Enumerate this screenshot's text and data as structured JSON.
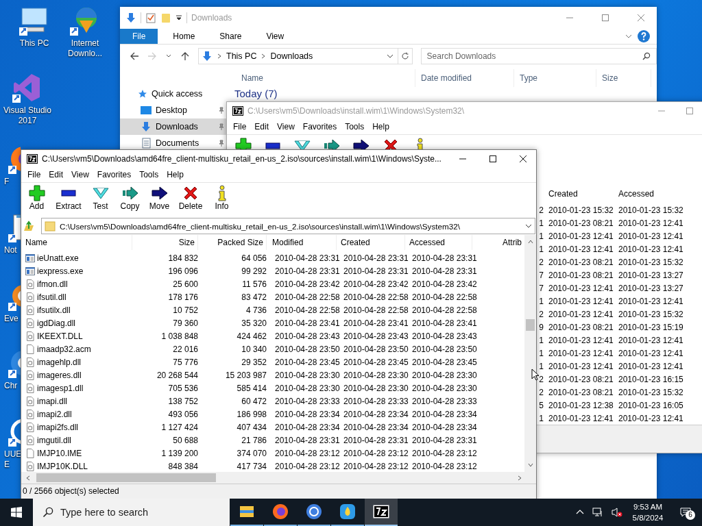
{
  "desktop_icons": [
    {
      "label": "This PC",
      "kind": "pc"
    },
    {
      "label": "Internet Downlo...",
      "kind": "idm"
    },
    {
      "label": "Visual Studio 2017",
      "kind": "vs"
    },
    {
      "label": "F",
      "kind": "firefox"
    },
    {
      "label": "Not",
      "kind": "notepad"
    },
    {
      "label": "Eve",
      "kind": "everything"
    },
    {
      "label": "Chr",
      "kind": "chrome"
    },
    {
      "label": "UUE E",
      "kind": "uue"
    }
  ],
  "explorer": {
    "title": "Downloads",
    "ribbon_tabs": [
      {
        "label": "File",
        "selected": true
      },
      {
        "label": "Home",
        "selected": false
      },
      {
        "label": "Share",
        "selected": false
      },
      {
        "label": "View",
        "selected": false
      }
    ],
    "breadcrumb": [
      "This PC",
      "Downloads"
    ],
    "search": {
      "placeholder": "Search Downloads"
    },
    "columns": [
      "Name",
      "Date modified",
      "Type",
      "Size"
    ],
    "group": "Today (7)",
    "nav": [
      {
        "label": "Quick access",
        "kind": "star",
        "pinned": false,
        "selected": false
      },
      {
        "label": "Desktop",
        "kind": "desktop",
        "pinned": true,
        "selected": false
      },
      {
        "label": "Downloads",
        "kind": "download",
        "pinned": true,
        "selected": true
      },
      {
        "label": "Documents",
        "kind": "documents",
        "pinned": true,
        "selected": false
      }
    ]
  },
  "back_window": {
    "title": "C:\\Users\\vm5\\Downloads\\install.wim\\1\\Windows\\System32\\",
    "menu": [
      "File",
      "Edit",
      "View",
      "Favorites",
      "Tools",
      "Help"
    ],
    "columns": [
      "Created",
      "Accessed"
    ],
    "rows": [
      {
        "modified_tail": "2",
        "created": "2010-01-23 15:32",
        "accessed": "2010-01-23 15:32"
      },
      {
        "modified_tail": "1",
        "created": "2010-01-23 08:21",
        "accessed": "2010-01-23 12:41"
      },
      {
        "modified_tail": "1",
        "created": "2010-01-23 12:41",
        "accessed": "2010-01-23 12:41"
      },
      {
        "modified_tail": "1",
        "created": "2010-01-23 12:41",
        "accessed": "2010-01-23 12:41"
      },
      {
        "modified_tail": "2",
        "created": "2010-01-23 08:21",
        "accessed": "2010-01-23 15:32"
      },
      {
        "modified_tail": "7",
        "created": "2010-01-23 08:21",
        "accessed": "2010-01-23 13:27"
      },
      {
        "modified_tail": "7",
        "created": "2010-01-23 12:41",
        "accessed": "2010-01-23 13:27"
      },
      {
        "modified_tail": "1",
        "created": "2010-01-23 12:41",
        "accessed": "2010-01-23 12:41"
      },
      {
        "modified_tail": "2",
        "created": "2010-01-23 12:41",
        "accessed": "2010-01-23 15:32"
      },
      {
        "modified_tail": "9",
        "created": "2010-01-23 08:21",
        "accessed": "2010-01-23 15:19"
      },
      {
        "modified_tail": "1",
        "created": "2010-01-23 12:41",
        "accessed": "2010-01-23 12:41"
      },
      {
        "modified_tail": "1",
        "created": "2010-01-23 12:41",
        "accessed": "2010-01-23 12:41"
      },
      {
        "modified_tail": "1",
        "created": "2010-01-23 12:41",
        "accessed": "2010-01-23 12:41"
      },
      {
        "modified_tail": "2",
        "created": "2010-01-23 08:21",
        "accessed": "2010-01-23 16:15"
      },
      {
        "modified_tail": "2",
        "created": "2010-01-23 08:21",
        "accessed": "2010-01-23 15:32"
      },
      {
        "modified_tail": "5",
        "created": "2010-01-23 12:38",
        "accessed": "2010-01-23 16:05"
      },
      {
        "modified_tail": "1",
        "created": "2010-01-23 12:41",
        "accessed": "2010-01-23 12:41"
      }
    ]
  },
  "front_window": {
    "title": "C:\\Users\\vm5\\Downloads\\amd64fre_client-multisku_retail_en-us_2.iso\\sources\\install.wim\\1\\Windows\\Syste...",
    "menu": [
      "File",
      "Edit",
      "View",
      "Favorites",
      "Tools",
      "Help"
    ],
    "toolbar": [
      {
        "label": "Add",
        "kind": "add"
      },
      {
        "label": "Extract",
        "kind": "extract"
      },
      {
        "label": "Test",
        "kind": "test"
      },
      {
        "label": "Copy",
        "kind": "copy"
      },
      {
        "label": "Move",
        "kind": "move"
      },
      {
        "label": "Delete",
        "kind": "delete"
      },
      {
        "label": "Info",
        "kind": "info"
      }
    ],
    "path": "C:\\Users\\vm5\\Downloads\\amd64fre_client-multisku_retail_en-us_2.iso\\sources\\install.wim\\1\\Windows\\System32\\",
    "columns": [
      "Name",
      "Size",
      "Packed Size",
      "Modified",
      "Created",
      "Accessed",
      "Attrib"
    ],
    "rows": [
      {
        "kind": "exe",
        "name": "ieUnatt.exe",
        "size": "184 832",
        "packed": "64 056",
        "modified": "2010-04-28 23:31",
        "created": "2010-04-28 23:31",
        "accessed": "2010-04-28 23:31"
      },
      {
        "kind": "exe",
        "name": "iexpress.exe",
        "size": "196 096",
        "packed": "99 292",
        "modified": "2010-04-28 23:31",
        "created": "2010-04-28 23:31",
        "accessed": "2010-04-28 23:31"
      },
      {
        "kind": "dll",
        "name": "ifmon.dll",
        "size": "25 600",
        "packed": "11 576",
        "modified": "2010-04-28 23:42",
        "created": "2010-04-28 23:42",
        "accessed": "2010-04-28 23:42"
      },
      {
        "kind": "dll",
        "name": "ifsutil.dll",
        "size": "178 176",
        "packed": "83 472",
        "modified": "2010-04-28 22:58",
        "created": "2010-04-28 22:58",
        "accessed": "2010-04-28 22:58"
      },
      {
        "kind": "dll",
        "name": "ifsutilx.dll",
        "size": "10 752",
        "packed": "4 736",
        "modified": "2010-04-28 22:58",
        "created": "2010-04-28 22:58",
        "accessed": "2010-04-28 22:58"
      },
      {
        "kind": "dll",
        "name": "igdDiag.dll",
        "size": "79 360",
        "packed": "35 320",
        "modified": "2010-04-28 23:41",
        "created": "2010-04-28 23:41",
        "accessed": "2010-04-28 23:41"
      },
      {
        "kind": "dll",
        "name": "IKEEXT.DLL",
        "size": "1 038 848",
        "packed": "424 462",
        "modified": "2010-04-28 23:43",
        "created": "2010-04-28 23:43",
        "accessed": "2010-04-28 23:43"
      },
      {
        "kind": "file",
        "name": "imaadp32.acm",
        "size": "22 016",
        "packed": "10 340",
        "modified": "2010-04-28 23:50",
        "created": "2010-04-28 23:50",
        "accessed": "2010-04-28 23:50"
      },
      {
        "kind": "dll",
        "name": "imagehlp.dll",
        "size": "75 776",
        "packed": "29 352",
        "modified": "2010-04-28 23:45",
        "created": "2010-04-28 23:45",
        "accessed": "2010-04-28 23:45"
      },
      {
        "kind": "dll",
        "name": "imageres.dll",
        "size": "20 268 544",
        "packed": "15 203 987",
        "modified": "2010-04-28 23:30",
        "created": "2010-04-28 23:30",
        "accessed": "2010-04-28 23:30"
      },
      {
        "kind": "dll",
        "name": "imagesp1.dll",
        "size": "705 536",
        "packed": "585 414",
        "modified": "2010-04-28 23:30",
        "created": "2010-04-28 23:30",
        "accessed": "2010-04-28 23:30"
      },
      {
        "kind": "dll",
        "name": "imapi.dll",
        "size": "138 752",
        "packed": "60 472",
        "modified": "2010-04-28 23:33",
        "created": "2010-04-28 23:33",
        "accessed": "2010-04-28 23:33"
      },
      {
        "kind": "dll",
        "name": "imapi2.dll",
        "size": "493 056",
        "packed": "186 998",
        "modified": "2010-04-28 23:34",
        "created": "2010-04-28 23:34",
        "accessed": "2010-04-28 23:34"
      },
      {
        "kind": "dll",
        "name": "imapi2fs.dll",
        "size": "1 127 424",
        "packed": "407 434",
        "modified": "2010-04-28 23:34",
        "created": "2010-04-28 23:34",
        "accessed": "2010-04-28 23:34"
      },
      {
        "kind": "dll",
        "name": "imgutil.dll",
        "size": "50 688",
        "packed": "21 786",
        "modified": "2010-04-28 23:31",
        "created": "2010-04-28 23:31",
        "accessed": "2010-04-28 23:31"
      },
      {
        "kind": "file",
        "name": "IMJP10.IME",
        "size": "1 139 200",
        "packed": "374 070",
        "modified": "2010-04-28 23:12",
        "created": "2010-04-28 23:12",
        "accessed": "2010-04-28 23:12"
      },
      {
        "kind": "dll",
        "name": "IMJP10K.DLL",
        "size": "848 384",
        "packed": "417 734",
        "modified": "2010-04-28 23:12",
        "created": "2010-04-28 23:12",
        "accessed": "2010-04-28 23:12"
      }
    ],
    "status": "0 / 2566 object(s) selected"
  },
  "taskbar": {
    "search": {
      "placeholder": "Type here to search"
    },
    "apps": [
      {
        "kind": "explorer",
        "selected": false
      },
      {
        "kind": "firefox",
        "selected": false
      },
      {
        "kind": "chrome",
        "selected": false
      },
      {
        "kind": "fire",
        "selected": false
      },
      {
        "kind": "sevenzip",
        "selected": true
      }
    ],
    "time": "9:53 AM",
    "date": "5/8/2024",
    "notifications": "6"
  }
}
